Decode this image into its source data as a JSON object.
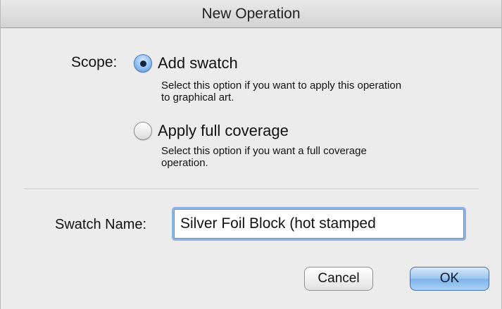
{
  "window": {
    "title": "New Operation"
  },
  "scope": {
    "label": "Scope:",
    "options": [
      {
        "label": "Add swatch",
        "description_line1": "Select this option if you want to apply this operation",
        "description_line2": "to graphical art.",
        "selected": true
      },
      {
        "label": "Apply full coverage",
        "description_line1": "Select this option if you want a full coverage",
        "description_line2": "operation.",
        "selected": false
      }
    ]
  },
  "swatch": {
    "label": "Swatch Name:",
    "value": "Silver Foil Block (hot stamped"
  },
  "buttons": {
    "cancel": "Cancel",
    "ok": "OK"
  },
  "colors": {
    "accent": "#8cb3e4",
    "default_button": "#9ac4ee"
  }
}
